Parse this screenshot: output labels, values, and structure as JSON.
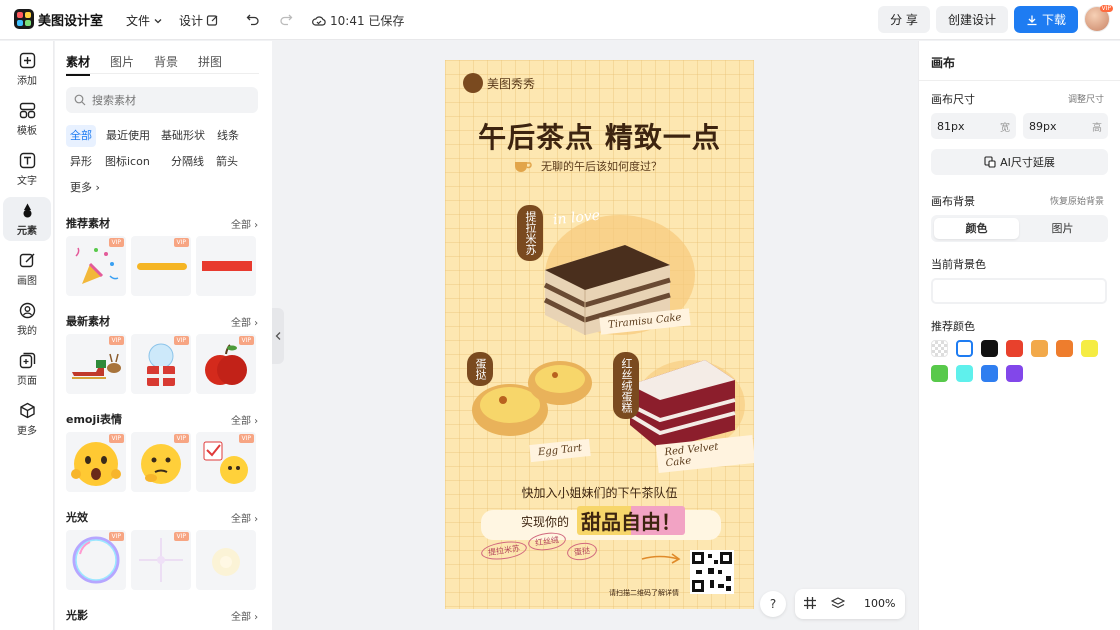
{
  "app": {
    "name": "美图设计室"
  },
  "topbar": {
    "menu_file": "文件",
    "menu_design": "设计",
    "saved_text": "10:41 已保存",
    "share": "分 享",
    "create": "创建设计",
    "download": "下载",
    "avatar_badge": "VIP"
  },
  "rail": [
    {
      "label": "添加",
      "icon": "plus-square-icon"
    },
    {
      "label": "模板",
      "icon": "template-icon"
    },
    {
      "label": "文字",
      "icon": "text-icon"
    },
    {
      "label": "元素",
      "icon": "shapes-icon",
      "active": true
    },
    {
      "label": "画图",
      "icon": "pencil-icon"
    },
    {
      "label": "我的",
      "icon": "user-icon"
    },
    {
      "label": "页面",
      "icon": "add-page-icon"
    },
    {
      "label": "更多",
      "icon": "cube-icon"
    }
  ],
  "panel": {
    "tabs": [
      "素材",
      "图片",
      "背景",
      "拼图"
    ],
    "search_placeholder": "搜索素材",
    "chips": [
      "全部",
      "最近使用",
      "基础形状",
      "线条",
      "异形",
      "图标icon",
      "分隔线",
      "箭头",
      "更多"
    ],
    "all_label": "全部",
    "vip": "VIP",
    "sections": [
      {
        "title": "推荐素材"
      },
      {
        "title": "最新素材"
      },
      {
        "title": "emoji表情"
      },
      {
        "title": "光效"
      },
      {
        "title": "光影"
      }
    ]
  },
  "poster": {
    "brand": "美图秀秀",
    "title": "午后茶点  精致一点",
    "subtitle": "无聊的午后该如何度过？",
    "tag_tiramisu": "提拉米苏",
    "label_in_love": "in love",
    "label_tiramisu": "Tiramisu Cake",
    "tag_eggtart": "蛋挞",
    "label_eggtart": "Egg Tart",
    "tag_redvelvet": "红丝绒蛋糕",
    "label_redvelvet": "Red Velvet Cake",
    "line1": "快加入小姐妹们的下午茶队伍",
    "line2_prefix": "实现你的",
    "line2_big": "甜品自由！",
    "hand1": "提拉米苏",
    "hand2": "红丝绒",
    "hand3": "蛋挞",
    "scan": "请扫描二维码了解详情"
  },
  "canvas_controls": {
    "help": "?",
    "zoom": "100%"
  },
  "right": {
    "title": "画布",
    "size_label": "画布尺寸",
    "size_adjust": "调整尺寸",
    "width_value": "81px",
    "width_unit": "宽",
    "height_value": "89px",
    "height_unit": "高",
    "ai_button": "AI尺寸延展",
    "bg_label": "画布背景",
    "bg_restore": "恢复原始背景",
    "seg_color": "颜色",
    "seg_image": "图片",
    "current_bg": "当前背景色",
    "recommend": "推荐颜色",
    "swatches": [
      "transparent",
      "#ffffff",
      "#111111",
      "#e8412c",
      "#f2a94a",
      "#ee7d2d",
      "#f5ec43",
      "#58c94b",
      "#5ff0ec",
      "#2f7ef0",
      "#8247ea"
    ]
  }
}
